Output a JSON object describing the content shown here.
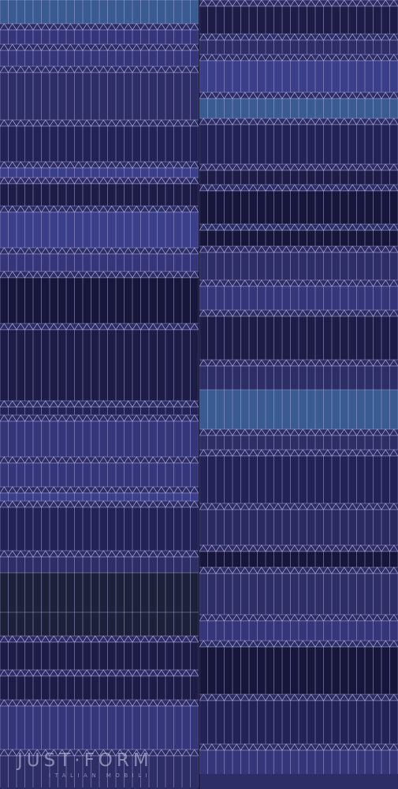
{
  "artwork": {
    "kind": "tile-pattern",
    "colors": {
      "line": "#b9b6e8",
      "palette": [
        "#2e2e66",
        "#35357a",
        "#3b3f8a",
        "#232256",
        "#1c1c46",
        "#16163a",
        "#3a5a92",
        "#2a2a60",
        "#1c2038"
      ]
    }
  },
  "watermark": {
    "brand": "JUST·FORM",
    "subtitle": "ITALIAN MOBILI"
  }
}
